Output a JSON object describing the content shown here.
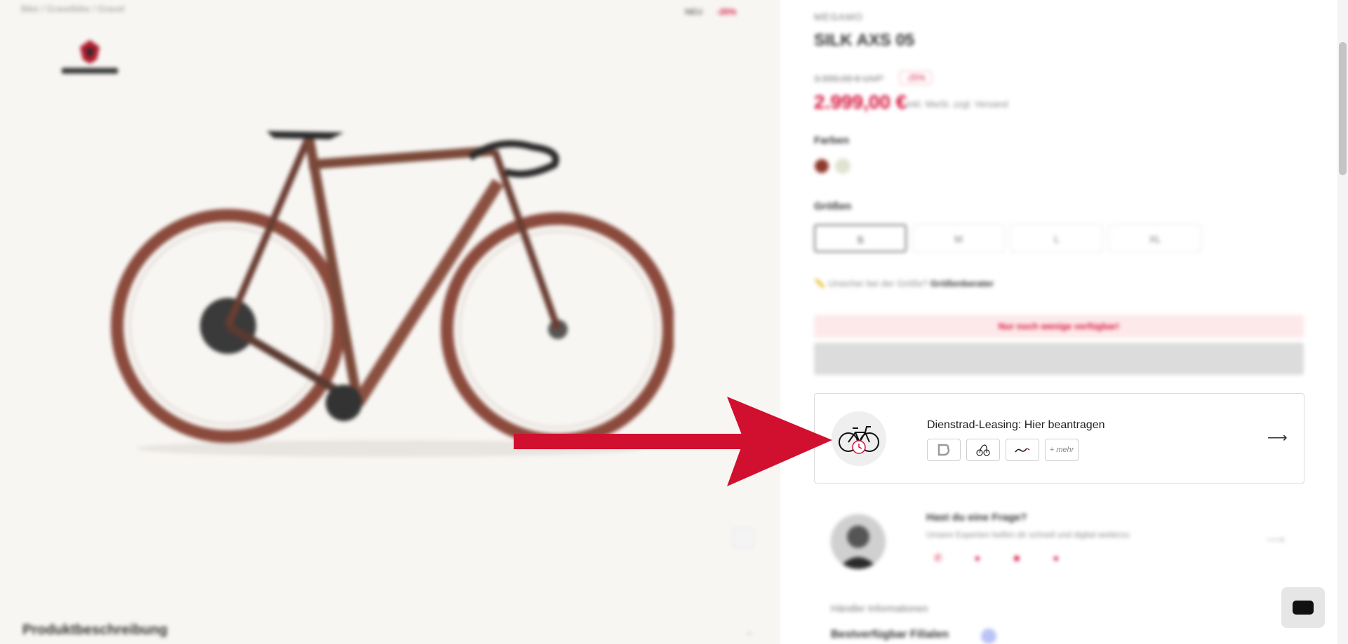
{
  "gallery": {
    "breadcrumb": "Bike / Gravelbike / Gravel",
    "badge_new": "NEU",
    "badge_sale": "-25%",
    "description_heading": "Produktbeschreibung"
  },
  "product": {
    "brand": "MEGAMO",
    "title": "SILK AXS 05",
    "old_price": "3.999,00 € UVP",
    "discount": "-25%",
    "price": "2.999,00 €",
    "vat_note": "inkl. MwSt. zzgl. Versand",
    "color_label": "Farben",
    "size_label": "Größen",
    "sizes": [
      "S",
      "M",
      "L",
      "XL"
    ],
    "size_hint_prefix": "Unsicher bei der Größe?",
    "size_hint_link": "Größenberater",
    "stock_notice": "Nur noch wenige verfügbar!"
  },
  "leasing": {
    "title": "Dienstrad-Leasing: Hier beantragen",
    "more_label": "+ mehr",
    "providers": [
      "bikeleasing-icon",
      "jobrad-icon",
      "eurorad-icon"
    ]
  },
  "contact": {
    "title": "Hast du eine Frage?",
    "subtitle": "Unsere Experten helfen dir schnell und digital weiterzu",
    "dealer_label": "Händler Informationen",
    "availability_label": "Bestverfügbar Filialen"
  },
  "colors": {
    "accent": "#d6103b",
    "arrow": "#d10f2f"
  }
}
